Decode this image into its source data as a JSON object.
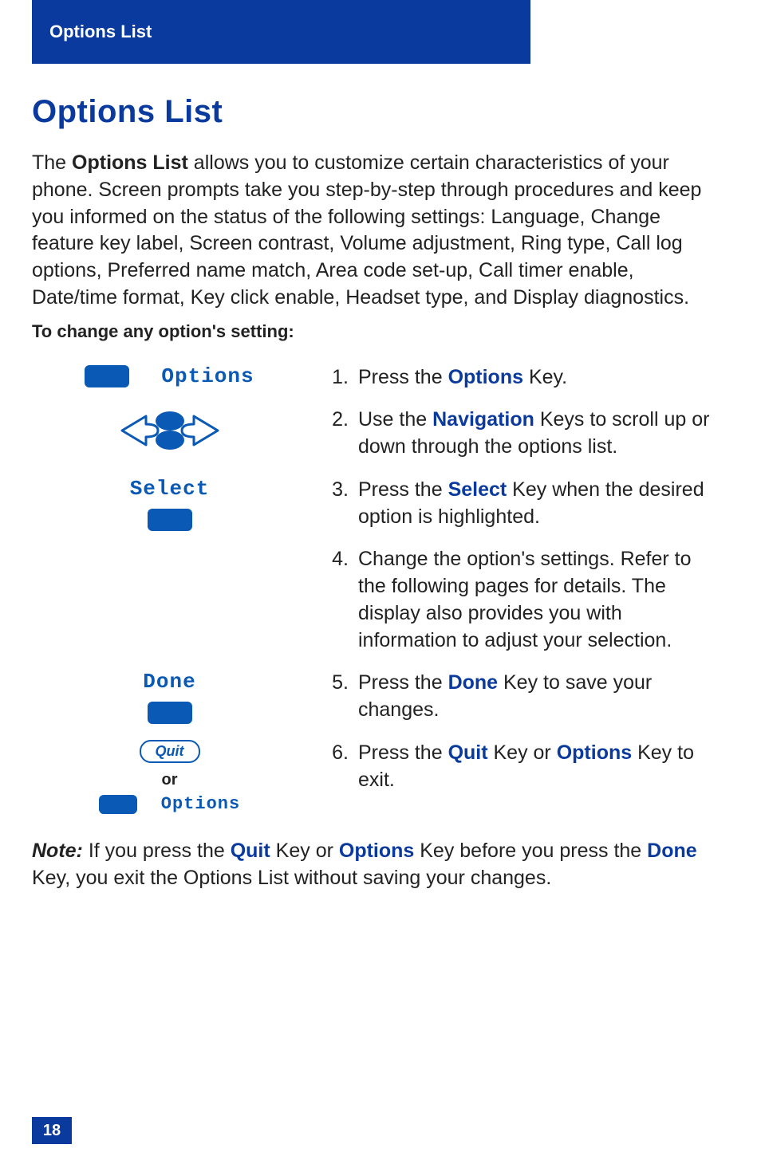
{
  "header": {
    "title": "Options List"
  },
  "title": "Options List",
  "intro": {
    "pre": "The ",
    "bold": "Options List",
    "post": " allows you to customize certain characteristics of your phone. Screen prompts take you step-by-step through procedures and keep you informed on the status of the following settings: Language, Change feature key label, Screen contrast, Volume adjustment, Ring type, Call log options, Preferred name match, Area code set-up, Call timer enable, Date/time format, Key click enable, Headset type, and Display diagnostics."
  },
  "subhead": "To change any option's setting:",
  "visuals": {
    "options_label": "Options",
    "select_label": "Select",
    "done_label": "Done",
    "quit_label": "Quit",
    "or_label": "or",
    "options_label2": "Options"
  },
  "steps": [
    {
      "n": "1.",
      "parts": [
        "Press the ",
        {
          "k": "Options"
        },
        " Key."
      ]
    },
    {
      "n": "2.",
      "parts": [
        "Use the ",
        {
          "k": "Navigation"
        },
        " Keys to scroll up or down through the options list."
      ]
    },
    {
      "n": "3.",
      "parts": [
        "Press the ",
        {
          "k": "Select"
        },
        " Key when the desired option is highlighted."
      ]
    },
    {
      "n": "4.",
      "parts": [
        "Change the option's settings. Refer to the following pages for details. The display also provides you with information to adjust your selection."
      ]
    },
    {
      "n": "5.",
      "parts": [
        "Press the ",
        {
          "k": "Done"
        },
        " Key to save your changes."
      ]
    },
    {
      "n": "6.",
      "parts": [
        "Press the ",
        {
          "k": "Quit"
        },
        " Key or ",
        {
          "k": "Options"
        },
        " Key to exit."
      ]
    }
  ],
  "note": {
    "label": "Note:",
    "parts": [
      " If you press the ",
      {
        "k": "Quit"
      },
      " Key or ",
      {
        "k": "Options"
      },
      " Key before you press the ",
      {
        "k": "Done"
      },
      " Key, you exit the Options List without saving your changes."
    ]
  },
  "page": "18"
}
